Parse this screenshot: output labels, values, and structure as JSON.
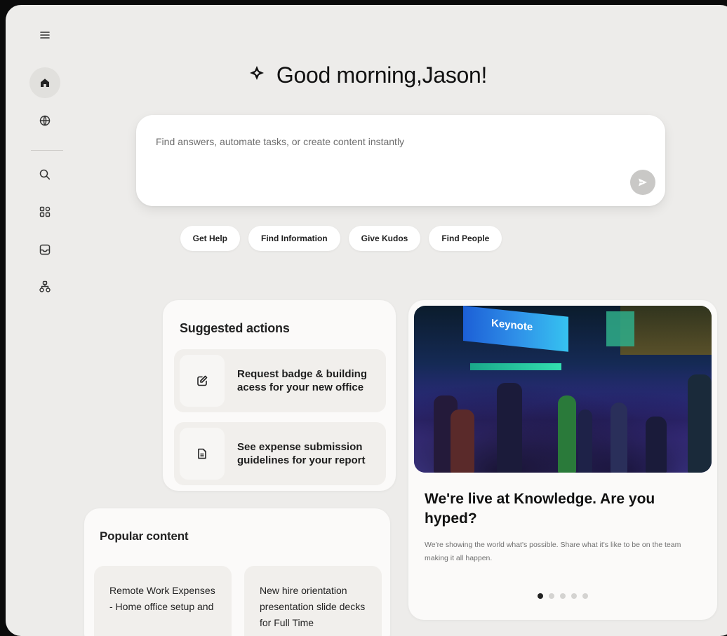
{
  "sidebar": {
    "items": [
      {
        "name": "menu-icon"
      },
      {
        "name": "home-icon",
        "active": true
      },
      {
        "name": "globe-icon"
      },
      {
        "name": "search-icon"
      },
      {
        "name": "apps-icon"
      },
      {
        "name": "inbox-icon"
      },
      {
        "name": "org-chart-icon"
      }
    ]
  },
  "header": {
    "greeting": "Good morning,Jason!",
    "greeting_icon": "sparkle-icon"
  },
  "prompt": {
    "placeholder": "Find answers, automate tasks, or create content instantly",
    "send_icon": "send-icon"
  },
  "quick_actions": [
    "Get Help",
    "Find Information",
    "Give Kudos",
    "Find People"
  ],
  "suggested": {
    "title": "Suggested actions",
    "items": [
      {
        "icon": "edit-icon",
        "label": "Request badge & building acess for your new office"
      },
      {
        "icon": "document-icon",
        "label": "See expense submission guidelines for your report"
      }
    ]
  },
  "popular": {
    "title": "Popular content",
    "items": [
      {
        "label": "Remote Work Expenses - Home office setup and"
      },
      {
        "label": "New hire orientation presentation slide decks for Full Time"
      }
    ]
  },
  "news": {
    "image_screen_text": "Keynote",
    "title": "We're live at Knowledge. Are you hyped?",
    "subtitle": "We're showing the world what's possible. Share what it's like to be on the team making it all happen.",
    "dots": 5,
    "active_dot": 0
  },
  "colors": {
    "background": "#edecea",
    "card": "#fbfaf9",
    "chip": "#ffffff",
    "send_button": "#c9c8c6"
  }
}
